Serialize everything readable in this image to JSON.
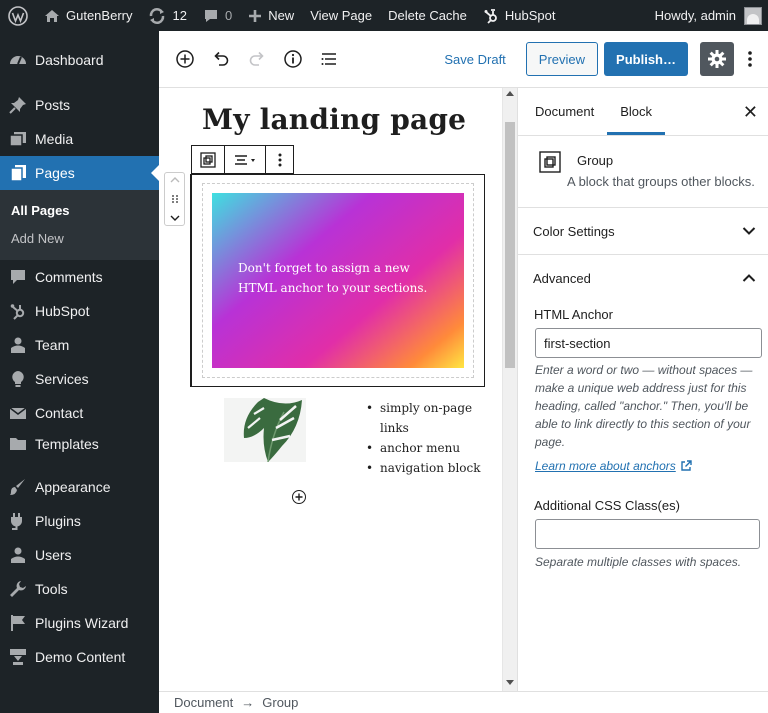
{
  "admin_bar": {
    "site_name": "GutenBerry",
    "updates_count": "12",
    "comments_count": "0",
    "new_label": "New",
    "view_page_label": "View Page",
    "delete_cache_label": "Delete Cache",
    "hubspot_label": "HubSpot",
    "howdy_label": "Howdy, admin"
  },
  "sidebar": {
    "items": [
      {
        "label": "Dashboard",
        "icon": "dashboard-icon"
      },
      {
        "label": "Posts",
        "icon": "pin-icon"
      },
      {
        "label": "Media",
        "icon": "media-icon"
      },
      {
        "label": "Pages",
        "icon": "pages-icon",
        "active": true
      },
      {
        "label": "Comments",
        "icon": "comments-icon"
      },
      {
        "label": "HubSpot",
        "icon": "hubspot-icon"
      },
      {
        "label": "Team",
        "icon": "team-icon"
      },
      {
        "label": "Services",
        "icon": "lightbulb-icon"
      },
      {
        "label": "Contact",
        "icon": "mail-icon"
      },
      {
        "label": "Templates",
        "icon": "folder-icon"
      },
      {
        "label": "Appearance",
        "icon": "paintbrush-icon"
      },
      {
        "label": "Plugins",
        "icon": "plugin-icon"
      },
      {
        "label": "Users",
        "icon": "users-icon"
      },
      {
        "label": "Tools",
        "icon": "wrench-icon"
      },
      {
        "label": "Plugins Wizard",
        "icon": "flag-icon"
      },
      {
        "label": "Demo Content",
        "icon": "download-icon"
      }
    ],
    "submenu": [
      {
        "label": "All Pages",
        "current": true
      },
      {
        "label": "Add New"
      }
    ]
  },
  "header": {
    "save_draft_label": "Save Draft",
    "preview_label": "Preview",
    "publish_label": "Publish…"
  },
  "canvas": {
    "post_title": "My landing page",
    "group_text": "Don't forget to assign a new HTML anchor to your sections.",
    "list_items": [
      "simply on-page links",
      "anchor menu",
      "navigation block"
    ],
    "list_lines": [
      "simply on-page",
      "links",
      "anchor menu",
      "navigation block"
    ]
  },
  "panel": {
    "tabs": [
      "Document",
      "Block"
    ],
    "active_tab": "Block",
    "block_name": "Group",
    "block_description": "A block that groups other blocks.",
    "color_settings_label": "Color Settings",
    "advanced_label": "Advanced",
    "html_anchor_label": "HTML Anchor",
    "html_anchor_value": "first-section",
    "anchor_help": "Enter a word or two — without spaces — make a unique web address just for this heading, called \"anchor.\" Then, you'll be able to link directly to this section of your page.",
    "anchor_help_lines": [
      "Enter a word or two — without spaces —",
      "make a unique web address just for this",
      "heading, called \"anchor.\" Then, you'll be",
      "able to link directly to this section of your",
      "page."
    ],
    "learn_more_label": "Learn more about anchors",
    "css_class_label": "Additional CSS Class(es)",
    "css_class_value": "",
    "css_class_help": "Separate multiple classes with spaces."
  },
  "footer": {
    "breadcrumb": [
      "Document",
      "Group"
    ]
  },
  "colors": {
    "admin_bg": "#1d2327",
    "accent": "#2271b1",
    "gradient": [
      "#3ee0e0",
      "#b832d6",
      "#e12ea8",
      "#ff8a3a",
      "#ffe642"
    ]
  }
}
